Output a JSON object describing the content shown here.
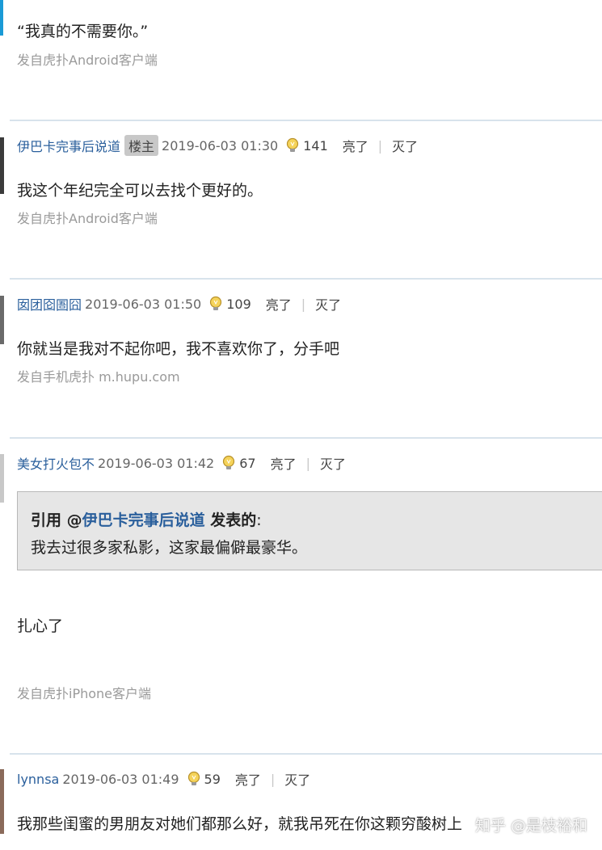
{
  "top_post": {
    "content": "“我真的不需要你。”",
    "source": "发自虎扑Android客户端"
  },
  "posts": [
    {
      "username": "伊巴卡完事后说道",
      "badge": "楼主",
      "time": "2019-06-03 01:30",
      "light_count": "141",
      "light_label": "亮了",
      "separator": "|",
      "dark_label": "灭了",
      "content": "我这个年纪完全可以去找个更好的。",
      "source": "发自虎扑Android客户端"
    },
    {
      "username": "囡团囵圄囧",
      "time": "2019-06-03 01:50",
      "light_count": "109",
      "light_label": "亮了",
      "separator": "|",
      "dark_label": "灭了",
      "content": "你就当是我对不起你吧，我不喜欢你了，分手吧",
      "source": "发自手机虎扑 m.hupu.com"
    },
    {
      "username": "美女打火包不",
      "time": "2019-06-03 01:42",
      "light_count": "67",
      "light_label": "亮了",
      "separator": "|",
      "dark_label": "灭了",
      "quote": {
        "prefix": "引用 @",
        "user": "伊巴卡完事后说道",
        "suffix": " 发表的",
        "colon": ":",
        "text": "我去过很多家私影，这家最偏僻最豪华。"
      },
      "content": "扎心了",
      "source": "发自虎扑iPhone客户端"
    },
    {
      "username": "lynnsa",
      "time": "2019-06-03 01:49",
      "light_count": "59",
      "light_label": "亮了",
      "separator": "|",
      "dark_label": "灭了",
      "content": "我那些闺蜜的男朋友对她们都那么好，就我吊死在你这颗穷酸树上"
    }
  ],
  "watermark": "知乎 @是枝裕和",
  "colors": {
    "username": "#2a5f9c",
    "meta_gray": "#666666",
    "source_gray": "#9a9a9a",
    "divider": "#d8e3ec",
    "quote_bg": "#e6e6e6",
    "top_accent": "#1a9ad6"
  },
  "icons": {
    "light": "lightbulb-icon"
  }
}
